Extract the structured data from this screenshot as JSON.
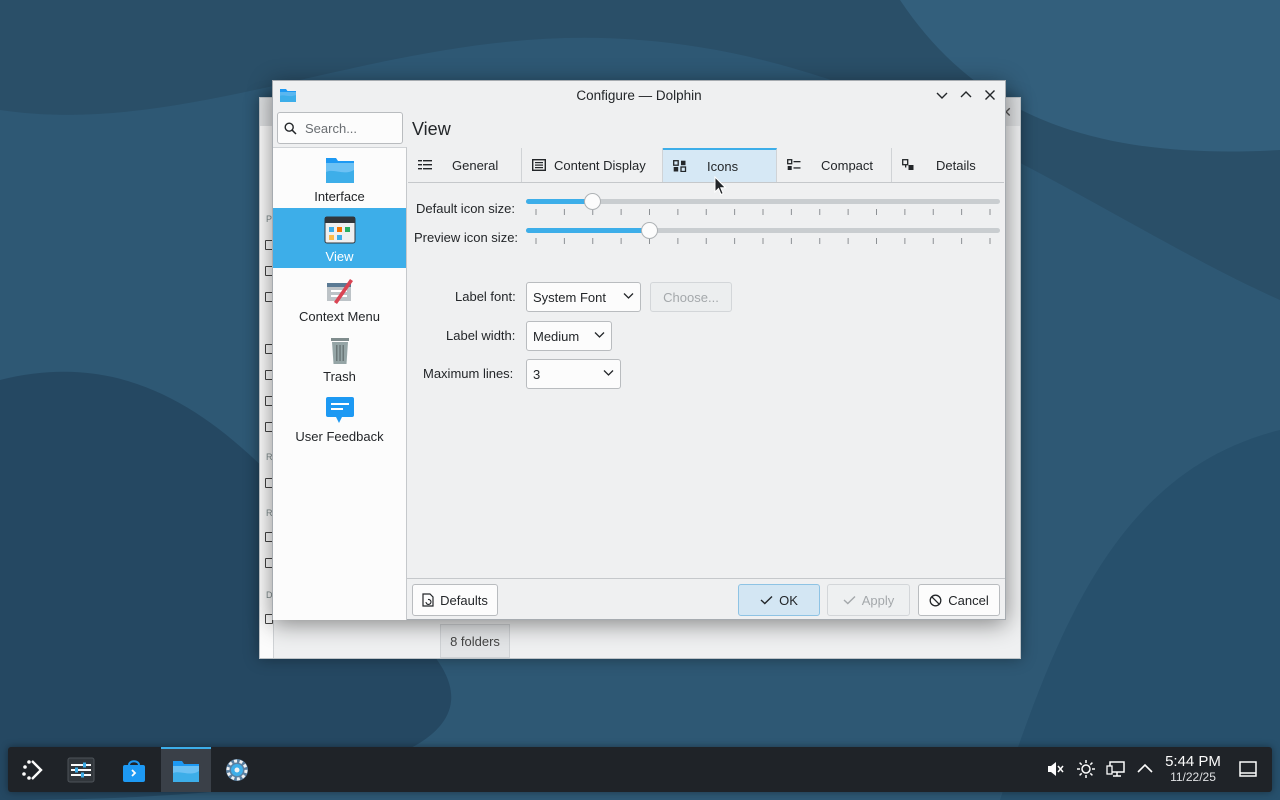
{
  "dialog": {
    "title": "Configure — Dolphin",
    "page_header": "View",
    "search": {
      "placeholder": "Search...",
      "value": ""
    }
  },
  "sidebar": {
    "items": [
      {
        "label": "Interface",
        "icon": "folder-icon",
        "selected": false
      },
      {
        "label": "View",
        "icon": "view-icon",
        "selected": true
      },
      {
        "label": "Context Menu",
        "icon": "context-menu-icon",
        "selected": false
      },
      {
        "label": "Trash",
        "icon": "trash-icon",
        "selected": false
      },
      {
        "label": "User Feedback",
        "icon": "feedback-icon",
        "selected": false
      }
    ]
  },
  "tabs": [
    {
      "label": "General",
      "icon": "list-icon",
      "active": false
    },
    {
      "label": "Content Display",
      "icon": "document-icon",
      "active": false
    },
    {
      "label": "Icons",
      "icon": "icons-view-icon",
      "active": true
    },
    {
      "label": "Compact",
      "icon": "compact-view-icon",
      "active": false
    },
    {
      "label": "Details",
      "icon": "details-view-icon",
      "active": false
    }
  ],
  "form": {
    "default_icon_size": {
      "label": "Default icon size:",
      "value_fraction": 0.14
    },
    "preview_icon_size": {
      "label": "Preview icon size:",
      "value_fraction": 0.26
    },
    "label_font": {
      "label": "Label font:",
      "value": "System Font",
      "choose_label": "Choose..."
    },
    "label_width": {
      "label": "Label width:",
      "value": "Medium"
    },
    "maximum_lines": {
      "label": "Maximum lines:",
      "value": "3"
    }
  },
  "buttons": {
    "defaults": "Defaults",
    "ok": "OK",
    "apply": "Apply",
    "cancel": "Cancel"
  },
  "background_window": {
    "status": "8 folders"
  },
  "taskbar": {
    "apps": [
      "application-launcher",
      "system-monitor",
      "discover-store",
      "dolphin-file-manager",
      "system-settings"
    ],
    "active_app": "dolphin-file-manager",
    "clock": {
      "time": "5:44 PM",
      "date": "11/22/25"
    }
  },
  "colors": {
    "accent": "#3daee9",
    "window_bg": "#eff0f1",
    "taskbar_bg": "#1f2328",
    "desktop_bg": "#2e5874"
  }
}
